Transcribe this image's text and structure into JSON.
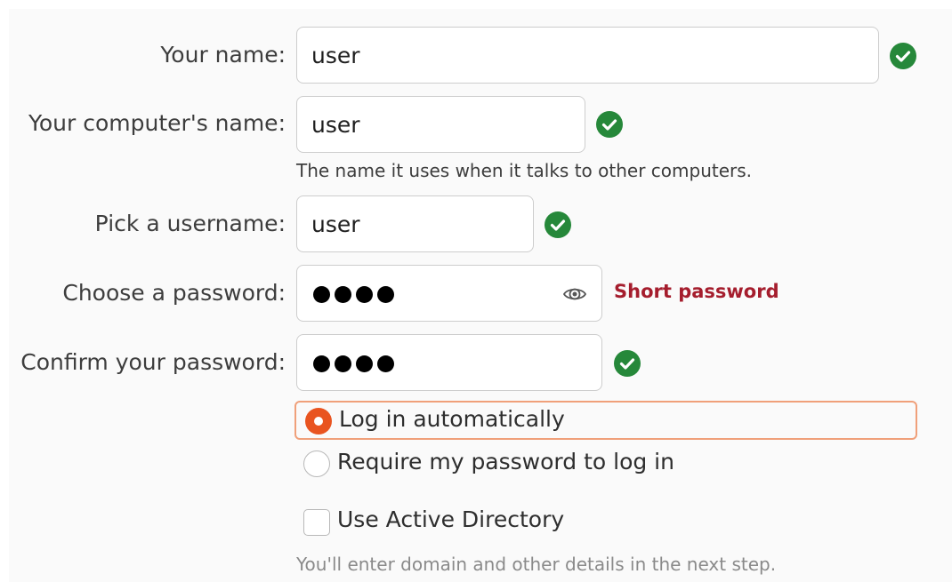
{
  "form": {
    "name_label": "Your name:",
    "name_value": "user",
    "computer_label": "Your computer's name:",
    "computer_value": "user",
    "computer_hint": "The name it uses when it talks to other computers.",
    "username_label": "Pick a username:",
    "username_value": "user",
    "password_label": "Choose a password:",
    "password_masked_length": 4,
    "password_strength": "Short password",
    "confirm_label": "Confirm your password:",
    "confirm_masked_length": 4
  },
  "login_options": {
    "auto_label": "Log in automatically",
    "auto_selected": true,
    "require_label": "Require my password to log in",
    "require_selected": false
  },
  "active_directory": {
    "label": "Use Active Directory",
    "checked": false,
    "hint": "You'll enter domain and other details in the next step."
  },
  "colors": {
    "accent": "#e95420",
    "valid_check": "#26883a",
    "warning": "#a51d2d",
    "focus_outline": "#f0a07a"
  },
  "icons": {
    "valid": "check-circle-icon",
    "reveal": "eye-icon"
  }
}
